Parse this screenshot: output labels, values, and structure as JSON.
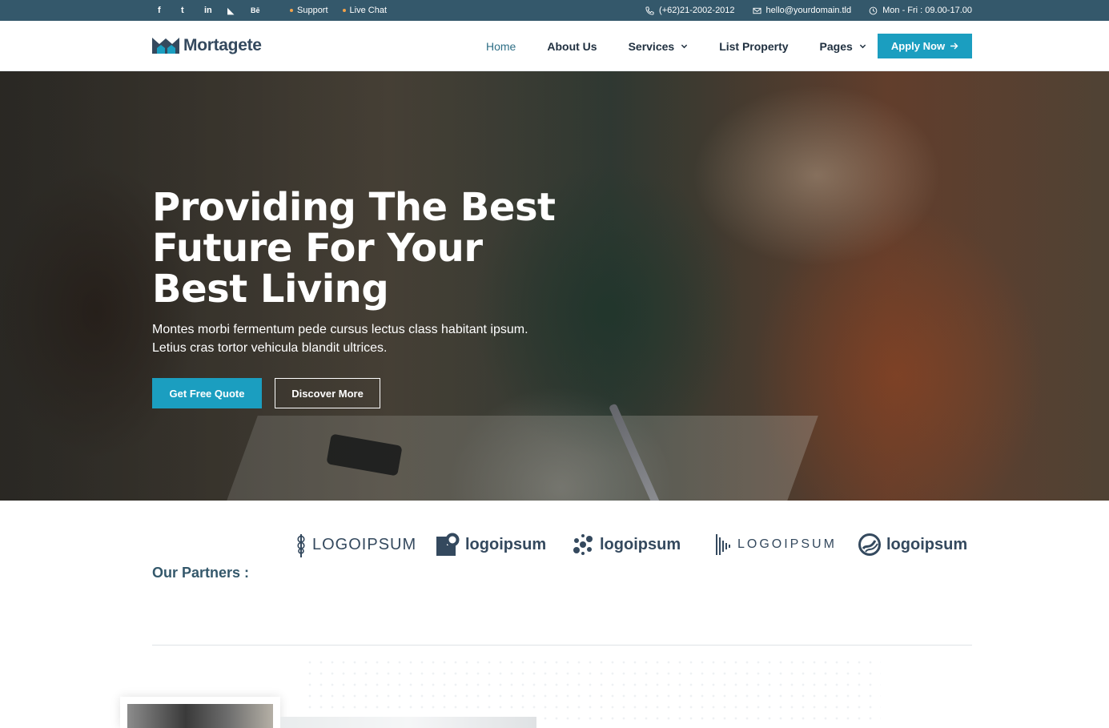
{
  "topbar": {
    "social": [
      {
        "icon": "facebook-icon",
        "glyph": "f"
      },
      {
        "icon": "twitter-icon",
        "glyph": "t"
      },
      {
        "icon": "linkedin-icon",
        "glyph": "in"
      },
      {
        "icon": "rss-icon",
        "glyph": "◣"
      },
      {
        "icon": "behance-icon",
        "glyph": "Bē"
      }
    ],
    "links": [
      "Support",
      "Live Chat"
    ],
    "phone": "(+62)21-2002-2012",
    "email": "hello@yourdomain.tld",
    "hours": "Mon - Fri : 09.00-17.00"
  },
  "header": {
    "brand": "Mortagete",
    "nav": [
      {
        "label": "Home",
        "active": true,
        "dropdown": false
      },
      {
        "label": "About Us",
        "active": false,
        "dropdown": false
      },
      {
        "label": "Services",
        "active": false,
        "dropdown": true
      },
      {
        "label": "List Property",
        "active": false,
        "dropdown": false
      },
      {
        "label": "Pages",
        "active": false,
        "dropdown": true
      }
    ],
    "cta": "Apply Now"
  },
  "hero": {
    "title": "Providing The Best Future For Your Best Living",
    "text": "Montes morbi fermentum pede cursus lectus class habitant ipsum. Letius cras tortor vehicula blandit ultrices.",
    "primary_button": "Get Free Quote",
    "secondary_button": "Discover More"
  },
  "partners": {
    "label": "Our Partners :",
    "logos": [
      {
        "text": "LOGOIPSUM",
        "icon": "wheat-logo-icon"
      },
      {
        "text": "logoipsum",
        "icon": "square-ring-logo-icon"
      },
      {
        "text": "logoipsum",
        "icon": "molecule-logo-icon"
      },
      {
        "text": "LOGOIPSUM",
        "icon": "bars-logo-icon"
      },
      {
        "text": "logoipsum",
        "icon": "circle-stripe-logo-icon"
      }
    ]
  },
  "colors": {
    "topbar": "#34586b",
    "accent": "#1b9ec0",
    "nav_active": "#2f6f86",
    "dot": "#f2a24a"
  }
}
